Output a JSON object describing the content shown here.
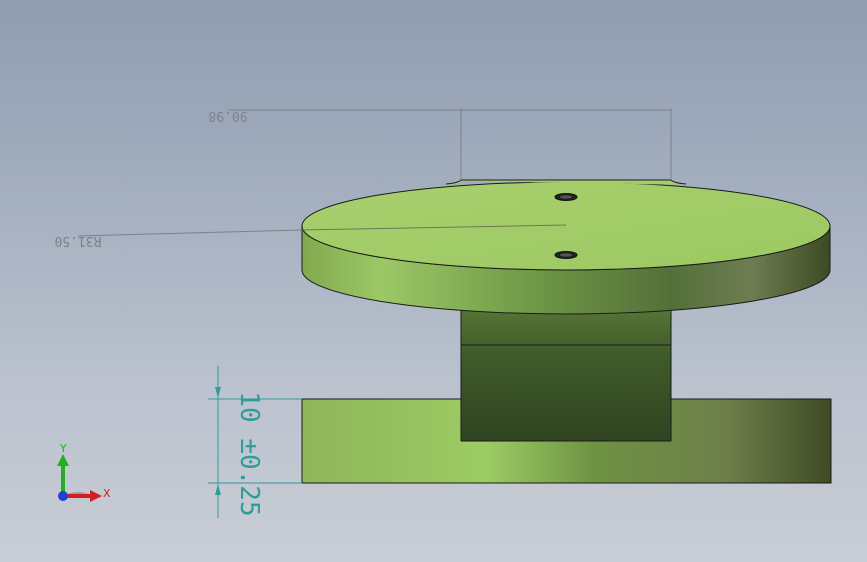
{
  "colors": {
    "background_top": "#8f9db1",
    "background_bottom": "#c9cdd5",
    "part_face": "#a2cc68",
    "part_side_light": "#96c466",
    "part_side_dark": "#3b4a22",
    "dimension_grey": "#7c818a",
    "dimension_teal": "#2f9c9a",
    "axis_x": "#d02020",
    "axis_y": "#20b020",
    "axis_z": "#2040d0"
  },
  "dimensions": {
    "top_width_label": "90.98",
    "radius_label": "R31.50",
    "height_label": "10 ±0.25"
  },
  "triad": {
    "x_label": "X",
    "y_label": "Y"
  },
  "icons": {
    "triad": "xyz-axis-triad-icon"
  }
}
